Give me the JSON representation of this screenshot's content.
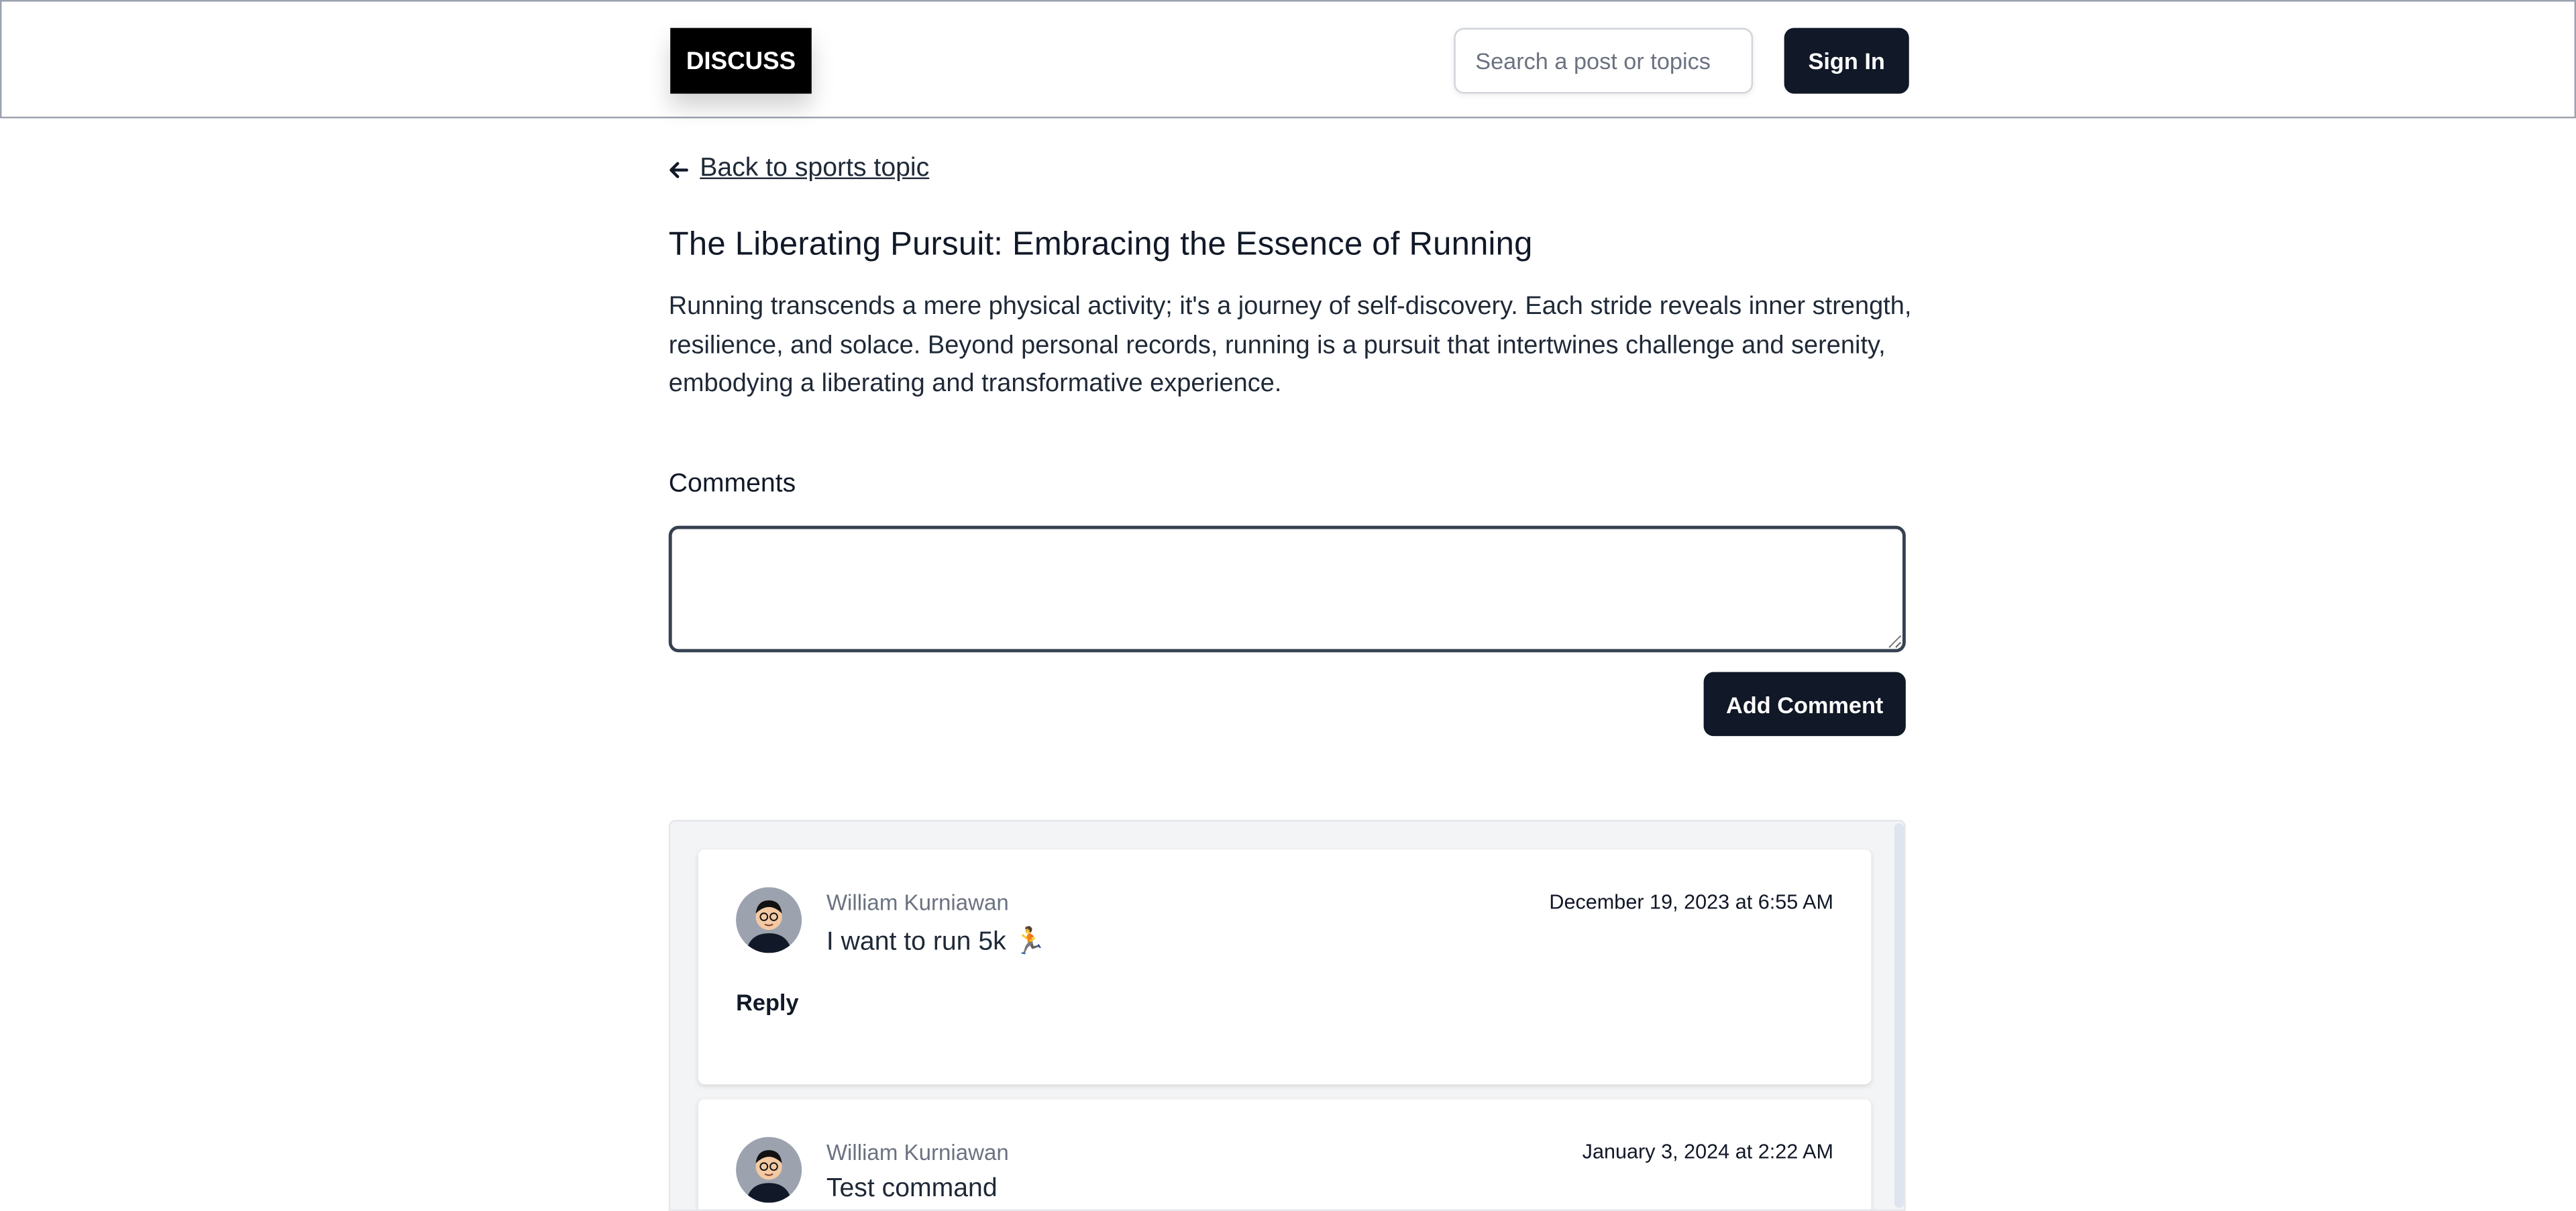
{
  "header": {
    "logo": "DISCUSS",
    "search_placeholder": "Search a post or topics",
    "signin_label": "Sign In"
  },
  "post": {
    "back_label": "Back to sports topic",
    "title": "The Liberating Pursuit: Embracing the Essence of Running",
    "body": "Running transcends a mere physical activity; it's a journey of self-discovery. Each stride reveals inner strength, resilience, and solace. Beyond personal records, running is a pursuit that intertwines challenge and serenity, embodying a liberating and transformative experience."
  },
  "comments_section": {
    "label": "Comments",
    "input_value": "",
    "add_button": "Add Comment"
  },
  "comments": [
    {
      "author": "William Kurniawan",
      "date": "December 19, 2023 at 6:55 AM",
      "text": "I want to run 5k 🏃",
      "reply_label": "Reply"
    },
    {
      "author": "William Kurniawan",
      "date": "January 3, 2024 at 2:22 AM",
      "text": "Test command"
    }
  ],
  "colors": {
    "primary": "#111827",
    "logo_bg": "#000000",
    "panel_bg": "#f3f4f6",
    "muted_text": "#6b7280"
  }
}
